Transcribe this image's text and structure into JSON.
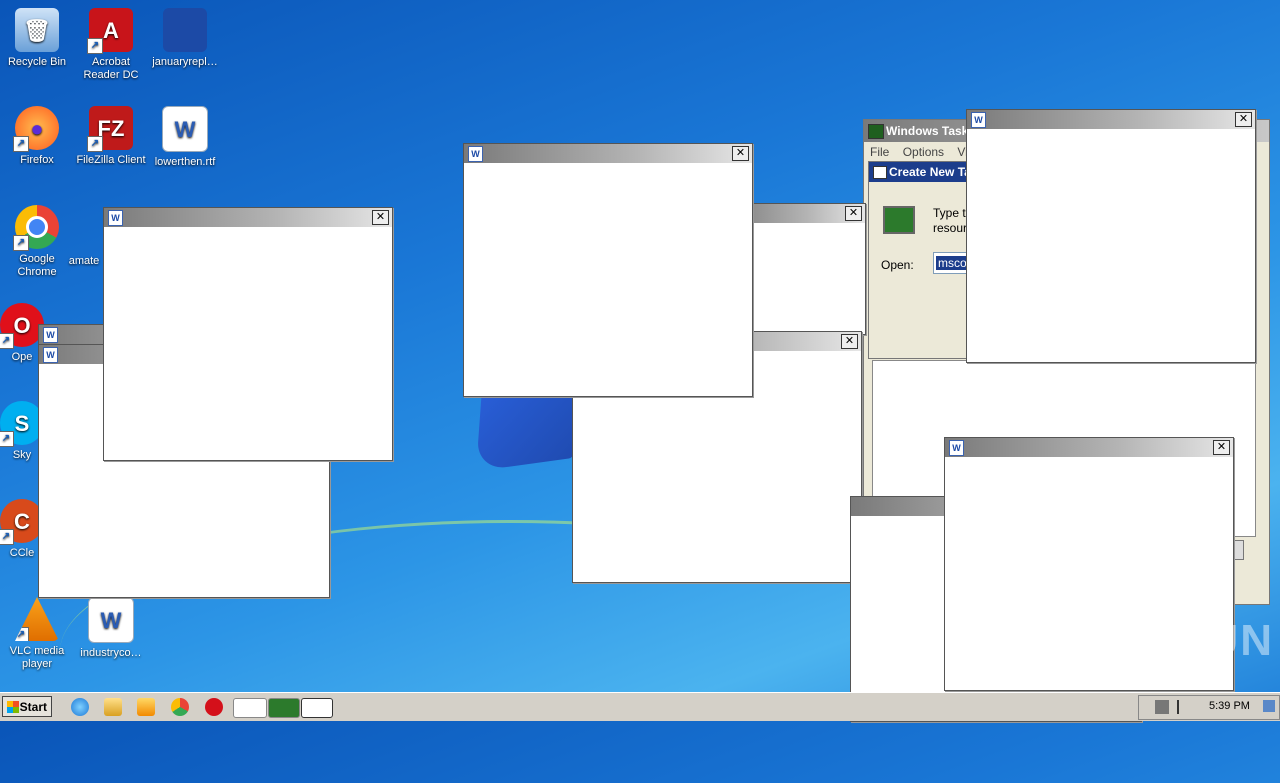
{
  "desktop": {
    "icons": [
      {
        "label": "Recycle Bin",
        "icon": "recycle-bin-icon",
        "color": "#6aa0d8"
      },
      {
        "label": "Acrobat Reader DC",
        "icon": "acrobat-icon",
        "color": "#c8141a"
      },
      {
        "label": "januaryrepl…",
        "icon": "document-icon",
        "color": "#1c4aa6"
      },
      {
        "label": "Firefox",
        "icon": "firefox-icon",
        "color": "#ff7a19"
      },
      {
        "label": "FileZilla Client",
        "icon": "filezilla-icon",
        "color": "#bf1a1a"
      },
      {
        "label": "lowerthen.rtf",
        "icon": "word-document-icon",
        "color": "#2b5cb3"
      },
      {
        "label": "Google Chrome",
        "icon": "chrome-icon",
        "color": "#34a853"
      },
      {
        "label": "amate",
        "icon": "document-icon",
        "color": "#ffffff"
      },
      {
        "label": "Ope",
        "icon": "opera-icon",
        "color": "#e0101a"
      },
      {
        "label": "Sky",
        "icon": "skype-icon",
        "color": "#00aff0"
      },
      {
        "label": "CCle",
        "icon": "ccleaner-icon",
        "color": "#d84a1b"
      },
      {
        "label": "VLC media player",
        "icon": "vlc-icon",
        "color": "#f28a00"
      },
      {
        "label": "industryco…",
        "icon": "word-document-icon",
        "color": "#2b5cb3"
      }
    ],
    "window_icon_letter": "W",
    "close_glyph": "✕"
  },
  "task_manager": {
    "title": "Windows Task",
    "menu": [
      "File",
      "Options",
      "View"
    ],
    "dialog_title": "Create New Ta",
    "dialog_text_line1": "Type t",
    "dialog_text_line2": "resour",
    "open_label": "Open:",
    "open_value": "msco"
  },
  "taskbar": {
    "start_label": "Start",
    "clock": "5:39 PM",
    "icons": [
      "ie-icon",
      "explorer-icon",
      "media-player-icon",
      "chrome-icon",
      "opera-icon",
      "word-icon",
      "taskmgr-icon",
      "run-dialog-icon"
    ]
  },
  "watermark": "ANY▷RUN"
}
